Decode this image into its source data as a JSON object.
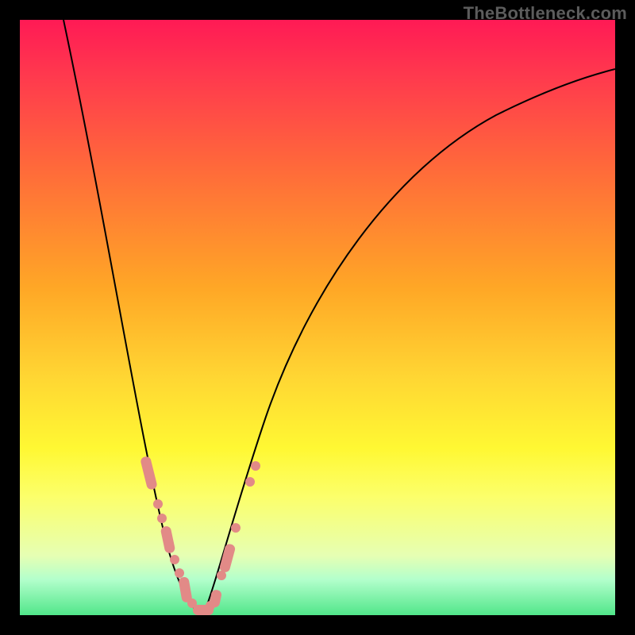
{
  "attribution": "TheBottleneck.com",
  "colors": {
    "background_frame": "#000000",
    "gradient_top": "#ff1a55",
    "gradient_mid": "#ffd633",
    "gradient_bottom": "#51e68a",
    "curve": "#000000",
    "marker": "#e28a87",
    "attribution_text": "#5c5c5c"
  },
  "chart_data": {
    "type": "line",
    "title": "",
    "xlabel": "",
    "ylabel": "",
    "xlim": [
      0,
      100
    ],
    "ylim": [
      0,
      100
    ],
    "grid": false,
    "series": [
      {
        "name": "left-branch",
        "x": [
          7,
          12,
          17,
          22,
          25,
          28,
          30
        ],
        "values": [
          100,
          60,
          30,
          12,
          6,
          2,
          0
        ]
      },
      {
        "name": "right-branch",
        "x": [
          31,
          35,
          41,
          50,
          62,
          80,
          100
        ],
        "values": [
          0,
          10,
          33,
          58,
          78,
          88,
          92
        ]
      }
    ],
    "annotations": [
      {
        "text": "TheBottleneck.com",
        "position": "top-right"
      }
    ],
    "markers": {
      "left-branch": [
        {
          "x": 21.5,
          "y": 25
        },
        {
          "x": 23,
          "y": 19
        },
        {
          "x": 24,
          "y": 16
        },
        {
          "x": 25,
          "y": 13
        },
        {
          "x": 26,
          "y": 9
        },
        {
          "x": 27,
          "y": 7
        },
        {
          "x": 28,
          "y": 4
        },
        {
          "x": 29,
          "y": 2
        },
        {
          "x": 30,
          "y": 1
        }
      ],
      "right-branch": [
        {
          "x": 32,
          "y": 2
        },
        {
          "x": 33,
          "y": 4
        },
        {
          "x": 34,
          "y": 7
        },
        {
          "x": 35,
          "y": 12
        },
        {
          "x": 36,
          "y": 15
        },
        {
          "x": 39,
          "y": 22
        },
        {
          "x": 40,
          "y": 25
        }
      ]
    }
  }
}
